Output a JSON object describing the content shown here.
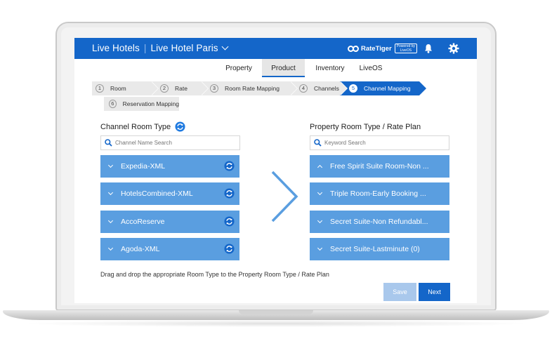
{
  "header": {
    "group_name": "Live Hotels",
    "hotel_name": "Live Hotel Paris",
    "brand": "RateTiger",
    "powered_by": "Powered by",
    "powered_product": "LiveOS",
    "accent_color": "#1466c9"
  },
  "topnav": {
    "tabs": [
      {
        "label": "Property",
        "active": false
      },
      {
        "label": "Product",
        "active": true
      },
      {
        "label": "Inventory",
        "active": false
      },
      {
        "label": "LiveOS",
        "active": false
      }
    ]
  },
  "steps": [
    {
      "num": "1",
      "label": "Room",
      "active": false
    },
    {
      "num": "2",
      "label": "Rate",
      "active": false
    },
    {
      "num": "3",
      "label": "Room Rate Mapping",
      "active": false
    },
    {
      "num": "4",
      "label": "Channels",
      "active": false
    },
    {
      "num": "5",
      "label": "Channel Mapping",
      "active": true
    },
    {
      "num": "6",
      "label": "Reservation Mapping",
      "active": false
    }
  ],
  "left": {
    "title": "Channel Room Type",
    "search_placeholder": "Channel Name Search",
    "items": [
      {
        "label": "Expedia-XML"
      },
      {
        "label": "HotelsCombined-XML"
      },
      {
        "label": "AccoReserve"
      },
      {
        "label": "Agoda-XML"
      }
    ]
  },
  "right": {
    "title": "Property Room Type / Rate Plan",
    "search_placeholder": "Keyword Search",
    "items": [
      {
        "label": "Free Spirit Suite Room-Non ...",
        "expanded": true
      },
      {
        "label": "Triple Room-Early Booking ...",
        "expanded": false
      },
      {
        "label": "Secret Suite-Non Refundabl...",
        "expanded": false
      },
      {
        "label": "Secret Suite-Lastminute (0)",
        "expanded": false
      }
    ]
  },
  "hint": "Drag and drop the appropriate Room Type to the Property Room Type / Rate Plan",
  "buttons": {
    "save": "Save",
    "next": "Next"
  }
}
